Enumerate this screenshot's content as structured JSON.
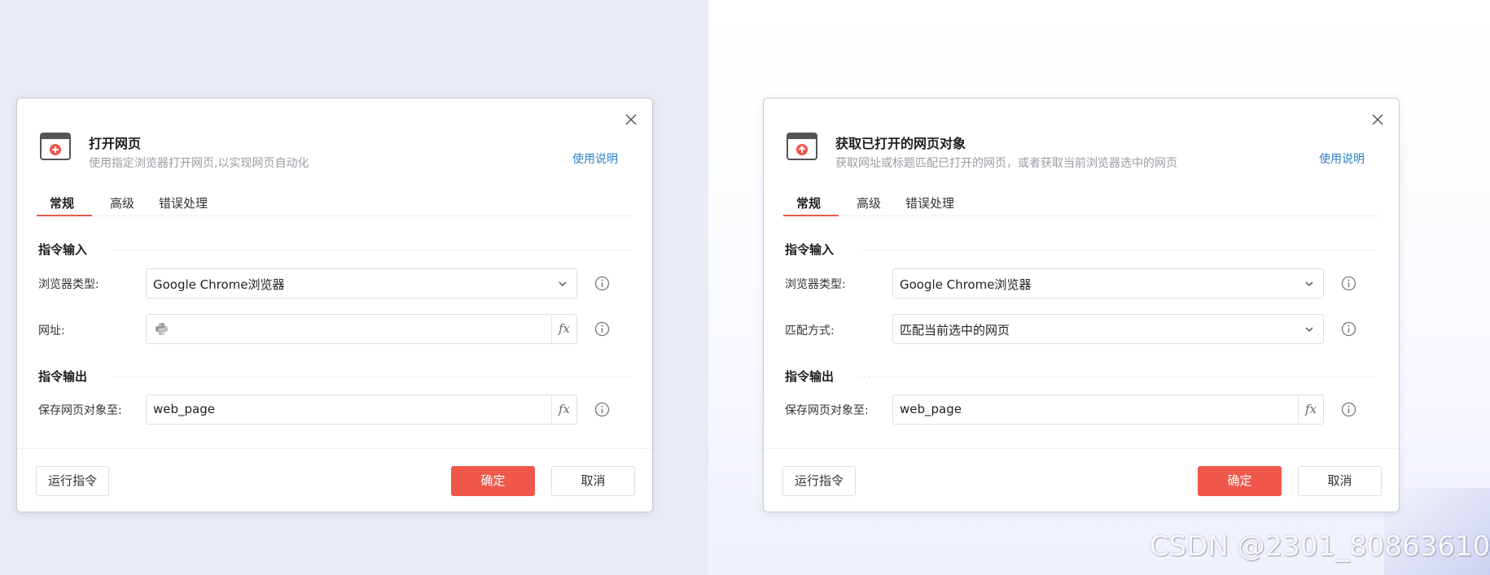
{
  "colors": {
    "accent": "#f0574b",
    "tab_underline": "#e8594c",
    "link": "#2e80c8",
    "left_background": "#e9ebf5"
  },
  "left_dialog": {
    "title": "打开网页",
    "subtitle": "使用指定浏览器打开网页,以实现网页自动化",
    "help_link": "使用说明",
    "icon": "browser-open-icon",
    "tabs": [
      {
        "label": "常规",
        "active": true
      },
      {
        "label": "高级",
        "active": false
      },
      {
        "label": "错误处理",
        "active": false
      }
    ],
    "input_section": "指令输入",
    "output_section": "指令输出",
    "fields": [
      {
        "label": "浏览器类型:",
        "value": "Google Chrome浏览器",
        "type": "select"
      },
      {
        "label": "网址:",
        "value": "",
        "type": "expression-python"
      },
      {
        "label": "保存网页对象至:",
        "value": "web_page",
        "type": "expression"
      }
    ],
    "fx_label": "fx",
    "buttons": {
      "run": "运行指令",
      "ok": "确定",
      "cancel": "取消"
    }
  },
  "right_dialog": {
    "title": "获取已打开的网页对象",
    "subtitle": "获取网址或标题匹配已打开的网页，或者获取当前浏览器选中的网页",
    "help_link": "使用说明",
    "icon": "browser-get-icon",
    "tabs": [
      {
        "label": "常规",
        "active": true
      },
      {
        "label": "高级",
        "active": false
      },
      {
        "label": "错误处理",
        "active": false
      }
    ],
    "input_section": "指令输入",
    "output_section": "指令输出",
    "fields": [
      {
        "label": "浏览器类型:",
        "value": "Google Chrome浏览器",
        "type": "select"
      },
      {
        "label": "匹配方式:",
        "value": "匹配当前选中的网页",
        "type": "select"
      },
      {
        "label": "保存网页对象至:",
        "value": "web_page",
        "type": "expression"
      }
    ],
    "fx_label": "fx",
    "buttons": {
      "run": "运行指令",
      "ok": "确定",
      "cancel": "取消"
    }
  },
  "watermark": "CSDN @2301_80863610"
}
